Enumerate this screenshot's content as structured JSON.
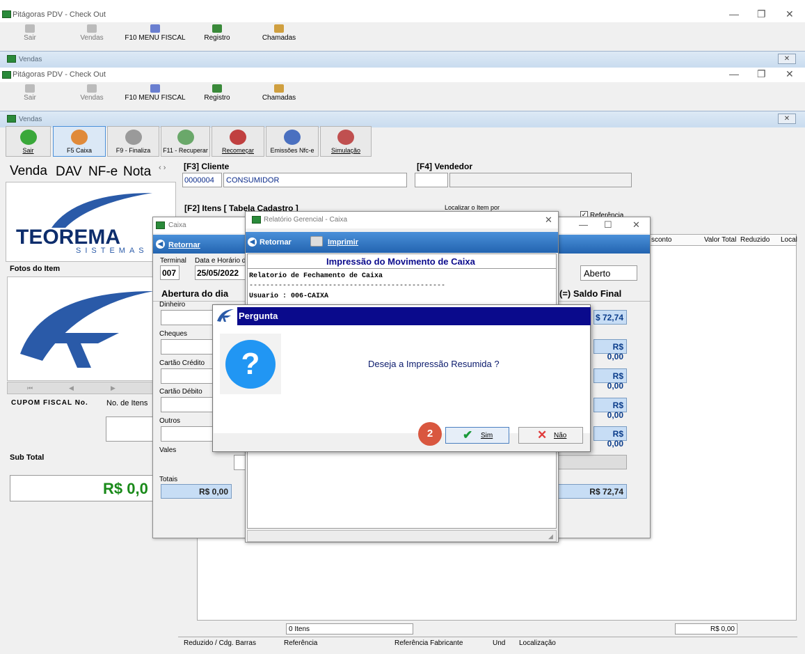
{
  "app_title": "Pitágoras PDV - Check Out",
  "toolbar": {
    "sair": "Sair",
    "vendas": "Vendas",
    "menu_fiscal": "F10 MENU FISCAL",
    "registro": "Registro",
    "chamadas": "Chamadas"
  },
  "vendas_title": "Vendas",
  "action_buttons": {
    "sair": "Sair",
    "caixa": "F5 Caixa",
    "finaliza": "F9 - Finaliza",
    "recuperar": "F11 - Recuperar",
    "recomecar": "Recomeçar",
    "emissoes": "Emissões Nfc-e",
    "simulacao": "Simulação"
  },
  "tabs": [
    "Venda",
    "DAV",
    "NF-e",
    "Nota"
  ],
  "tab_arrows": "‹ ›",
  "cliente": {
    "label": "[F3] Cliente",
    "code": "0000004",
    "name": "CONSUMIDOR"
  },
  "vendedor": {
    "label": "[F4] Vendedor"
  },
  "logo": {
    "brand": "TEOREMA",
    "sub": "SISTEMAS"
  },
  "fotos_label": "Fotos do Item",
  "cupom_label": "CUPOM FISCAL No.",
  "no_itens_label": "No. de Itens",
  "subtotal_label": "Sub Total",
  "subtotal_value": "R$ 0,0",
  "itens": {
    "label": "[F2] Itens [ Tabela Cadastro ]",
    "localizar": "Localizar o Item por",
    "referencia": "Referência"
  },
  "grid_headers": {
    "desconto": "sconto",
    "valor_total": "Valor Total",
    "reduzido": "Reduzido",
    "local": "Local"
  },
  "grid_footer": {
    "itens": "0 Itens",
    "total": "R$ 0,00"
  },
  "bottom_headers": [
    "Reduzido / Cdg. Barras",
    "Referência",
    "Referência Fabricante",
    "Und",
    "Localização"
  ],
  "caixa": {
    "title": "Caixa",
    "retornar": "Retornar",
    "terminal_label": "Terminal",
    "terminal": "007",
    "data_label": "Data e Horário de",
    "data": "25/05/2022",
    "status": "Aberto",
    "abertura_label": "Abertura do dia",
    "saldo_label": "(=) Saldo Final",
    "rows": [
      "Dinheiro",
      "Cheques",
      "Cartão Crédito",
      "Cartão Débito",
      "Outros",
      "Vales",
      "Totais"
    ],
    "saldos": [
      "$ 72,74",
      "R$ 0,00",
      "R$ 0,00",
      "R$ 0,00",
      "R$ 0,00"
    ],
    "totais_abertura": "R$ 0,00",
    "totais_saldo": "R$ 72,74"
  },
  "relatorio": {
    "title": "Relatório Gerencial - Caixa",
    "retornar": "Retornar",
    "imprimir": "Imprimir",
    "heading": "Impressão do Movimento de Caixa",
    "lines": [
      "Relatorio de Fechamento de Caixa",
      "-----------------------------------------------",
      "Usuario : 006-CAIXA"
    ]
  },
  "pergunta": {
    "title": "Pergunta",
    "message": "Deseja a Impressão Resumida ?",
    "sim": "Sim",
    "nao": "Não"
  },
  "step_badge": "2",
  "colors": {
    "dialog_title": "#0a0a8c",
    "accent_blue": "#2364b0",
    "money_text": "#0b3c8a",
    "subtotal_green": "#1a8a1a",
    "badge": "#d9573f"
  }
}
